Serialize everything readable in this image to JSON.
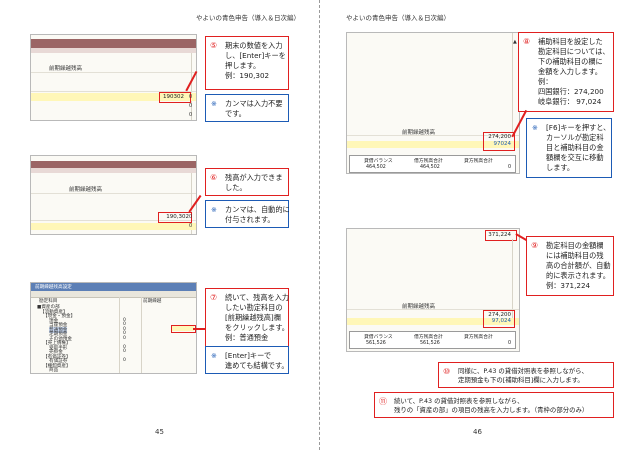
{
  "header": {
    "left": "やよいの青色申告（導入＆日次編）",
    "right": "やよいの青色申告（導入＆日次編）"
  },
  "page_numbers": {
    "left": "45",
    "right": "46"
  },
  "left_page": {
    "shot1": {
      "column_header": "前期繰越残高",
      "entered_value": "190302",
      "zeros": [
        "0",
        "0",
        "0"
      ]
    },
    "callout5": {
      "num": "⑤",
      "lines": [
        "期末の数値を入力",
        "し、[Enter]キーを",
        "押します。",
        "例：190,302"
      ]
    },
    "note5": {
      "num": "※",
      "lines": [
        "カンマは入力不要",
        "です。"
      ]
    },
    "shot2": {
      "column_header": "前期繰越残高",
      "entered_value": "190,302",
      "zeros": [
        "0",
        "0"
      ]
    },
    "callout6": {
      "num": "⑥",
      "lines": [
        "残高が入力できま",
        "した。"
      ]
    },
    "note6": {
      "num": "※",
      "lines": [
        "カンマは、自動的に",
        "付与されます。"
      ]
    },
    "shot3": {
      "title": "前期繰越残高設定",
      "tree_header": "勘定科目",
      "col2_header": "前期繰越",
      "tree_items": [
        "■資産の部",
        "【流動資産】",
        "【現金・預金】",
        "現金",
        "当座預金",
        "普通預金",
        "定期預金",
        "その他預金",
        "【売上債権】",
        "受取手形",
        "売掛金",
        "【有価証券】",
        "有価証券",
        "【棚卸資産】",
        "商品"
      ],
      "tree_values": [
        "0",
        "0",
        "0",
        "0",
        "0",
        "0",
        "0",
        "0"
      ]
    },
    "callout7": {
      "num": "⑦",
      "lines": [
        "続いて、残高を入力",
        "したい勘定科目の",
        "[前期繰越残高]欄",
        "をクリックします。",
        "例：普通預金"
      ]
    },
    "note7": {
      "num": "※",
      "lines": [
        "[Enter]キーで",
        "進めても結構です。"
      ]
    }
  },
  "right_page": {
    "shot4": {
      "column_header": "前期繰越残高",
      "value_top": "274,200",
      "value_input": "97024",
      "summary_headers": [
        "貸借バランス",
        "借方残高合計",
        "貸方残高合計"
      ],
      "summary_values": [
        "464,502",
        "464,502",
        "0"
      ]
    },
    "callout8": {
      "num": "⑧",
      "lines": [
        "補助科目を設定した",
        "勘定科目については、",
        "下の補助科目の欄に",
        "金額を入力します。",
        "例：",
        "四国銀行：274,200",
        "岐阜銀行：  97,024"
      ]
    },
    "note8": {
      "num": "※",
      "lines": [
        "[F6]キーを押すと、",
        "カーソルが勘定科",
        "目と補助科目の金",
        "額欄を交互に移動",
        "します。"
      ]
    },
    "shot5": {
      "column_header": "前期繰越残高",
      "value_total": "371,224",
      "value_a": "274,200",
      "value_b": "97,024",
      "summary_headers": [
        "貸借バランス",
        "借方残高合計",
        "貸方残高合計"
      ],
      "summary_values": [
        "561,526",
        "561,526",
        "0"
      ]
    },
    "callout9": {
      "num": "⑨",
      "lines": [
        "勘定科目の金額欄",
        "には補助科目の残",
        "高の合計額が、自動",
        "的に表示されます。",
        "例：371,224"
      ]
    },
    "callout10": {
      "num": "⑩",
      "lines": [
        "同様に、P.43 の貸借対照表を参照しながら、",
        "定期預金も下の[補助科目]欄に入力します。"
      ]
    },
    "callout11": {
      "num": "⑪",
      "lines": [
        "続いて、P.43 の貸借対照表を参照しながら、",
        "残りの「資産の部」の項目の残高を入力します。（青枠の部分のみ）"
      ]
    }
  }
}
